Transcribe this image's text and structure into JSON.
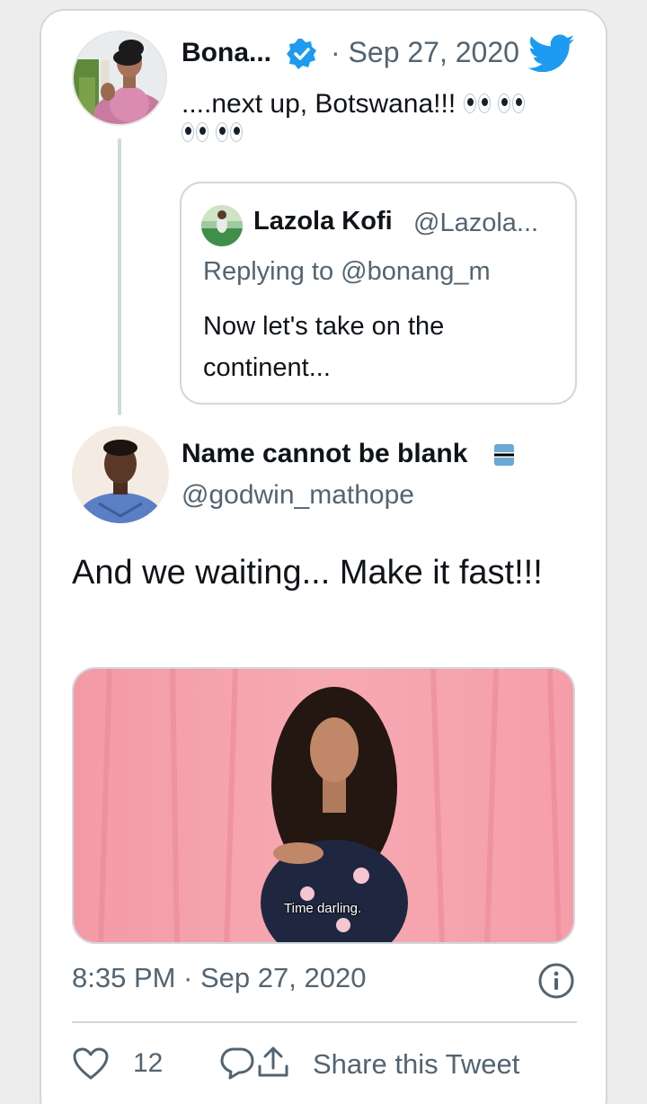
{
  "parent_tweet": {
    "author_name": "Bona...",
    "date": "· Sep 27, 2020",
    "text": "....next up, Botswana!!!"
  },
  "quoted_tweet": {
    "author_name": "Lazola Kofi",
    "handle": "@Lazola...",
    "replying_to": "Replying to @bonang_m",
    "text": "Now let's take on the continent..."
  },
  "main_tweet": {
    "author_name": "Name cannot be blank",
    "handle": "@godwin_mathope",
    "text": "And we waiting... Make it fast!!!",
    "media_caption": "Time darling.",
    "timestamp": "8:35 PM · Sep 27, 2020"
  },
  "actions": {
    "like_count": "12",
    "share_label": "Share this Tweet"
  },
  "icons": {
    "verified": "verified-badge-icon",
    "twitter": "twitter-bird-icon",
    "info": "info-icon",
    "like": "heart-icon",
    "reply": "reply-icon",
    "share": "share-icon"
  },
  "colors": {
    "accent": "#1d9bf0",
    "secondary_text": "#536471",
    "border": "#cfd9de"
  }
}
